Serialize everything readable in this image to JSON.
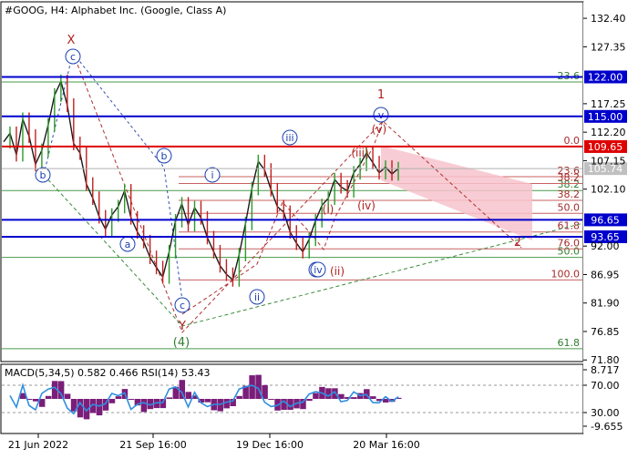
{
  "header": {
    "title": "#GOOG, H4:  Alphabet Inc. (Google, Class A)"
  },
  "chart_data": {
    "type": "line",
    "symbol": "#GOOG",
    "timeframe": "H4",
    "instrument": "Alphabet Inc. (Google, Class A)",
    "ylim": [
      72.0,
      135.0
    ],
    "y_ticks": [
      "132.40",
      "127.35",
      "122.00",
      "117.25",
      "115.00",
      "112.20",
      "109.65",
      "107.15",
      "105.74",
      "102.10",
      "96.65",
      "93.65",
      "92.00",
      "86.95",
      "81.90",
      "76.85",
      "71.80"
    ],
    "x_ticks": [
      "21 Jun 2022",
      "21 Sep 16:00",
      "19 Dec 16:00",
      "20 Mar 16:00"
    ],
    "price": {
      "name": "GOOG",
      "values": [
        110.5,
        112.0,
        108.2,
        114.5,
        111.5,
        106.5,
        109.0,
        113.5,
        118.8,
        121.2,
        117.0,
        110.2,
        108.5,
        103.0,
        100.5,
        97.2,
        95.0,
        97.5,
        99.0,
        101.8,
        97.0,
        94.5,
        92.8,
        90.0,
        88.2,
        86.5,
        91.0,
        96.5,
        99.5,
        95.8,
        98.8,
        97.0,
        93.5,
        91.0,
        88.5,
        87.0,
        86.0,
        90.5,
        96.0,
        102.2,
        107.0,
        105.5,
        102.0,
        99.0,
        98.0,
        94.5,
        92.5,
        91.0,
        93.2,
        96.5,
        99.2,
        100.5,
        103.8,
        102.5,
        101.8,
        105.0,
        106.5,
        108.5,
        106.8,
        105.0,
        106.0,
        104.8,
        105.74
      ]
    },
    "levels": [
      {
        "value": 122.0,
        "label": "122.00",
        "color": "#0000cc",
        "kind": "blue"
      },
      {
        "value": 115.0,
        "label": "115.00",
        "color": "#0000cc",
        "kind": "blue"
      },
      {
        "value": 109.65,
        "label": "109.65",
        "color": "#dd0000",
        "kind": "red"
      },
      {
        "value": 96.65,
        "label": "96.65",
        "color": "#0000cc",
        "kind": "blue"
      },
      {
        "value": 93.65,
        "label": "93.65",
        "color": "#0000cc",
        "kind": "blue"
      }
    ],
    "current_price": {
      "value": 105.74,
      "label": "105.74"
    },
    "fib_green_left": [
      {
        "value": 121.1,
        "label": "23.6"
      },
      {
        "value": 101.85,
        "label": "38.2"
      },
      {
        "value": 90.0,
        "label": "50.0"
      },
      {
        "value": 73.8,
        "label": "61.8"
      }
    ],
    "fib_right": [
      {
        "value": 109.65,
        "label": "0.0"
      },
      {
        "value": 104.3,
        "label": "23.6"
      },
      {
        "value": 103.1,
        "label": "38.2"
      },
      {
        "value": 100.1,
        "label": "38.2"
      },
      {
        "value": 97.8,
        "label": "50.0"
      },
      {
        "value": 94.5,
        "label": "61.8"
      },
      {
        "value": 91.5,
        "label": "76.0"
      },
      {
        "value": 86.0,
        "label": "100.0"
      }
    ],
    "wave_labels": [
      "X",
      "c",
      "b",
      "a",
      "b",
      "i",
      "c",
      "Y",
      "(4)",
      "ii",
      "iii",
      "i",
      "(i)",
      "iv",
      "(ii)",
      "(iii)",
      "(iv)",
      "(v)",
      "v",
      "1",
      "2"
    ],
    "indicator": {
      "label": "MACD(5,34,5) 0.582 0.466 RSI(14) 53.43",
      "y_ticks": [
        "8.717",
        "70.00",
        "30.00",
        "-9.655"
      ]
    }
  }
}
